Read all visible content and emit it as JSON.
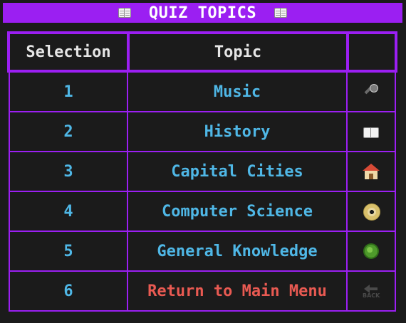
{
  "title": "QUIZ TOPICS",
  "header": {
    "selection": "Selection",
    "topic": "Topic",
    "icon": ""
  },
  "rows": [
    {
      "selection": "1",
      "topic": "Music",
      "icon": "microphone-icon"
    },
    {
      "selection": "2",
      "topic": "History",
      "icon": "open-book-icon"
    },
    {
      "selection": "3",
      "topic": "Capital Cities",
      "icon": "house-icon"
    },
    {
      "selection": "4",
      "topic": "Computer Science",
      "icon": "dvd-disc-icon"
    },
    {
      "selection": "5",
      "topic": "General Knowledge",
      "icon": "microbe-icon"
    },
    {
      "selection": "6",
      "topic": "Return to Main Menu",
      "icon": "back-arrow-icon",
      "back_label": "BACK"
    }
  ],
  "colors": {
    "accent": "#9b1ff2",
    "topic_text": "#4fb7e6",
    "return_text": "#e95a52",
    "header_text": "#e6e6e6",
    "background": "#1b1b1b"
  }
}
